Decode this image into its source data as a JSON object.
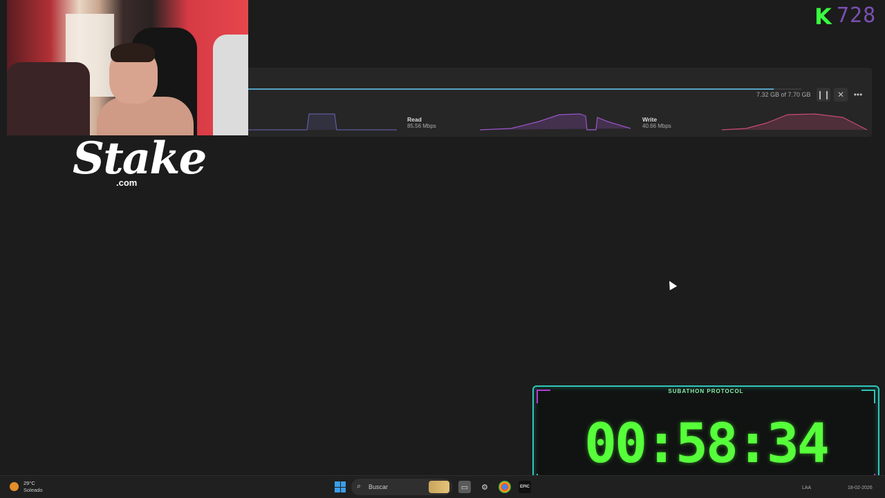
{
  "download": {
    "progress_fraction": 0.95,
    "size_text": "7.32 GB of 7.70 GB",
    "read_label": "Read",
    "read_value": "85.56 Mbps",
    "write_label": "Write",
    "write_value": "40.66 Mbps",
    "colors": {
      "progress": "#54a3c4",
      "read_graph": "#9b55c8",
      "write_graph": "#c84a78"
    }
  },
  "stake": {
    "word": "Stake",
    "domain": ".com"
  },
  "k_logo": {
    "letter": "K",
    "number": "728"
  },
  "timer": {
    "title": "SUBATHON PROTOCOL",
    "time": "00:58:34",
    "colors": {
      "digits": "#56ff3a",
      "frame": "#2fc7b9",
      "accent": "#b43cd6"
    }
  },
  "taskbar": {
    "weather_temp": "29°C",
    "weather_desc": "Soleado",
    "search_placeholder": "Buscar",
    "tray_lang": "LAA",
    "tray_date": "18-02-2026",
    "icons": [
      "windows-start-icon",
      "search-icon",
      "file-explorer-icon",
      "settings-icon",
      "chrome-icon",
      "epic-games-icon"
    ]
  }
}
